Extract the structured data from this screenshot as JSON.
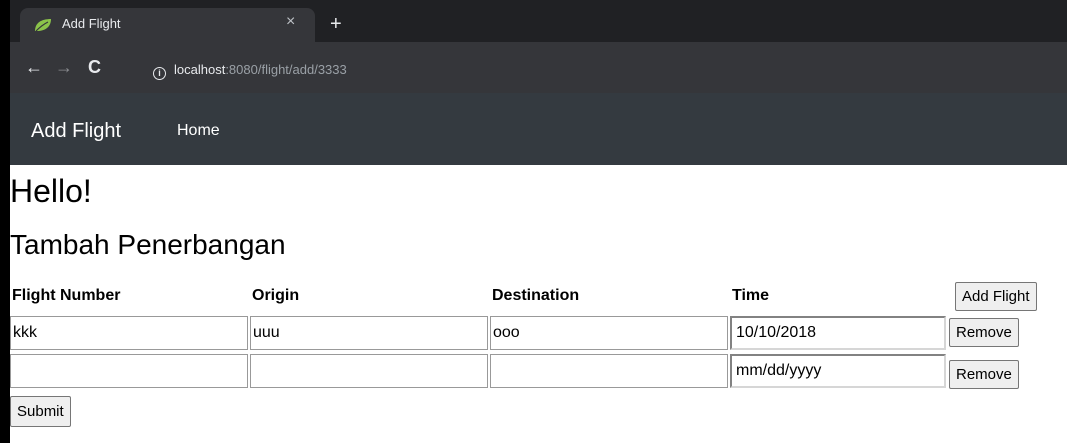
{
  "browser": {
    "tab_title": "Add Flight",
    "tab_close": "×",
    "new_tab": "+",
    "url_host": "localhost",
    "url_rest": ":8080/flight/add/3333",
    "icons": {
      "back": "arrow-left",
      "forward": "arrow-right",
      "reload": "reload",
      "info": "info-circle",
      "favicon": "leaf"
    }
  },
  "navbar": {
    "brand": "Add Flight",
    "home": "Home"
  },
  "page": {
    "greeting": "Hello!",
    "heading": "Tambah Penerbangan"
  },
  "table": {
    "headers": [
      "Flight Number",
      "Origin",
      "Destination",
      "Time"
    ],
    "add_button": "Add Flight",
    "rows": [
      {
        "flight_number": "kkk",
        "origin": "uuu",
        "destination": "ooo",
        "time": "10/10/2018",
        "remove": "Remove"
      },
      {
        "flight_number": "",
        "origin": "",
        "destination": "",
        "time": "mm/dd/yyyy",
        "remove": "Remove"
      }
    ]
  },
  "form": {
    "submit": "Submit"
  },
  "colors": {
    "tabstrip_bg": "#202124",
    "toolbar_bg": "#35363a",
    "navbar_bg": "#343a40",
    "favicon_green": "#8bc34a"
  }
}
